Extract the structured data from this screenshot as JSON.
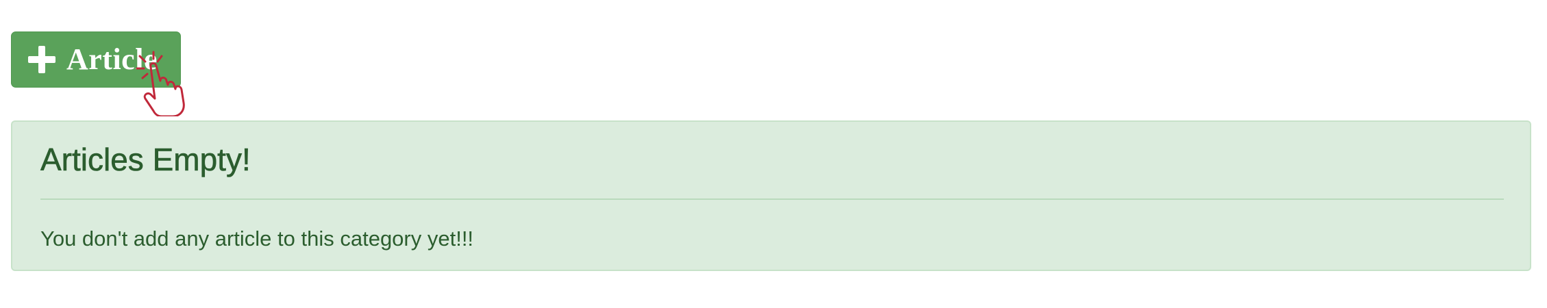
{
  "toolbar": {
    "add_article_label": "Article",
    "add_icon": "plus-icon"
  },
  "cursor": {
    "icon": "hand-pointer-click-icon",
    "color": "#c0283a"
  },
  "alert": {
    "title": "Articles Empty!",
    "message": "You don't add any article to this category yet!!!",
    "background": "#dbecdd",
    "text_color": "#2b5d2e"
  },
  "colors": {
    "button_green": "#5aa25a"
  }
}
